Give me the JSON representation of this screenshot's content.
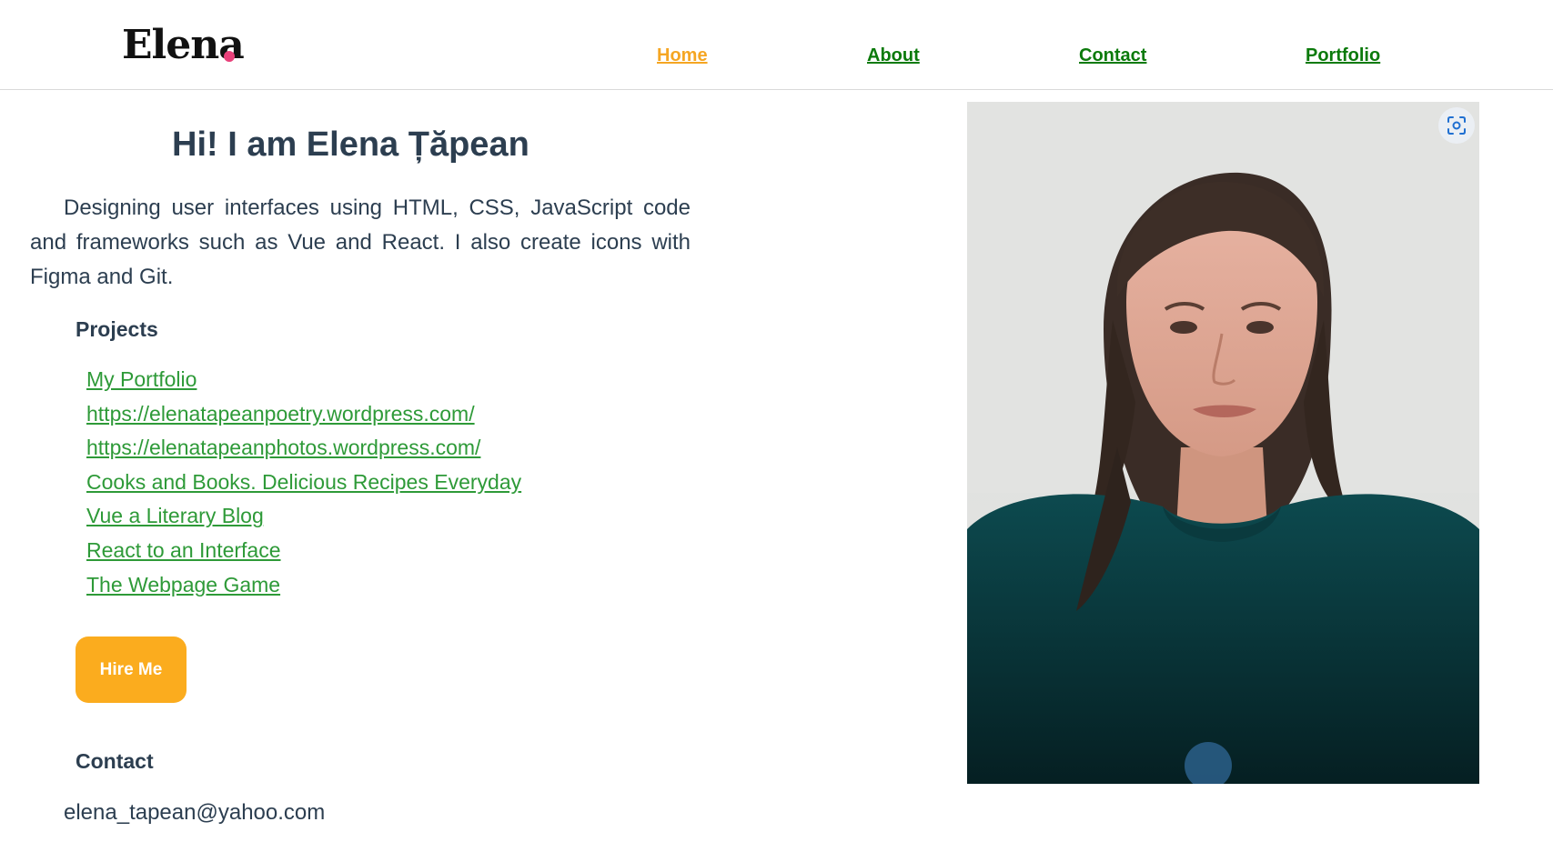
{
  "header": {
    "logo": "Elena",
    "nav": {
      "home": "Home",
      "about": "About",
      "contact": "Contact",
      "portfolio": "Portfolio"
    }
  },
  "main": {
    "title": "Hi! I am Elena Țăpean",
    "intro": "Designing user interfaces using HTML, CSS, JavaScript code and frameworks such as Vue and React. I also create icons with Figma and Git.",
    "projects_heading": "Projects",
    "projects": [
      "My Portfolio",
      "https://elenatapeanpoetry.wordpress.com/",
      "https://elenatapeanphotos.wordpress.com/",
      "Cooks and Books. Delicious Recipes Everyday",
      "Vue a Literary Blog",
      "React to an Interface",
      "The Webpage Game"
    ],
    "hire_button": "Hire Me",
    "contact_heading": "Contact",
    "email": "elena_tapean@yahoo.com"
  },
  "photo": {
    "icon": "scan-icon"
  },
  "colors": {
    "nav_active": "#f5a623",
    "nav_link": "#0b7a0b",
    "project_link": "#2e9a38",
    "button": "#fbac1e",
    "logo_dot": "#e8407a",
    "text": "#2c3e50"
  }
}
